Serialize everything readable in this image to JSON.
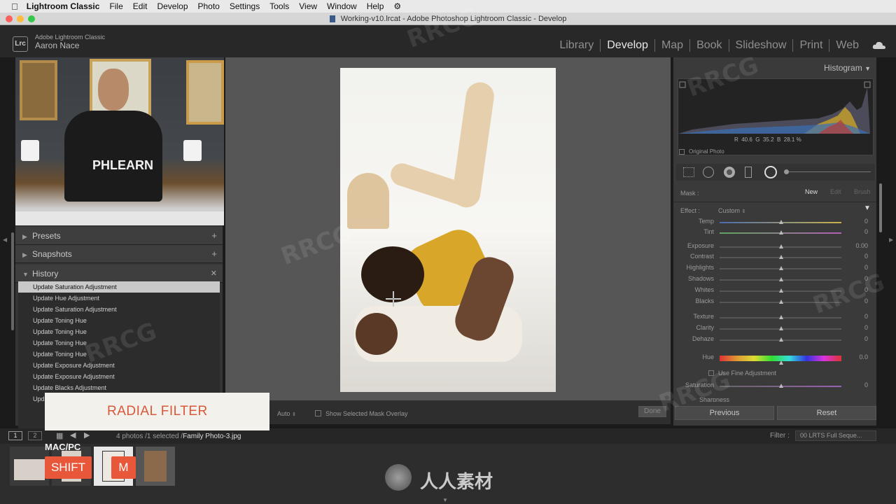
{
  "menubar": {
    "app_name": "Lightroom Classic",
    "items": [
      "File",
      "Edit",
      "Develop",
      "Photo",
      "Settings",
      "Tools",
      "View",
      "Window",
      "Help"
    ]
  },
  "window": {
    "title": "Working-v10.lrcat - Adobe Photoshop Lightroom Classic - Develop"
  },
  "identity": {
    "badge": "Lrc",
    "product": "Adobe Lightroom Classic",
    "user": "Aaron Nace"
  },
  "modules": [
    "Library",
    "Develop",
    "Map",
    "Book",
    "Slideshow",
    "Print",
    "Web"
  ],
  "presenter_shirt": "PHLEARN",
  "left_panel": {
    "presets": "Presets",
    "snapshots": "Snapshots",
    "history": "History",
    "history_items": [
      "Update Saturation Adjustment",
      "Update Hue Adjustment",
      "Update Saturation Adjustment",
      "Update Toning Hue",
      "Update Toning Hue",
      "Update Toning Hue",
      "Update Toning Hue",
      "Update Exposure Adjustment",
      "Update Exposure Adjustment",
      "Update Blacks Adjustment",
      "Upd"
    ]
  },
  "toolbar": {
    "auto": "Auto",
    "overlay": "Show Selected Mask Overlay",
    "done": "Done"
  },
  "overlay": {
    "title": "RADIAL FILTER",
    "platform": "MAC/PC",
    "key1": "SHIFT",
    "key2": "M"
  },
  "right_panel": {
    "histogram": "Histogram",
    "rgb": {
      "r_label": "R",
      "r": "40.6",
      "g_label": "G",
      "g": "35.2",
      "b_label": "B",
      "b": "28.1",
      "unit": "%"
    },
    "original_photo": "Original Photo",
    "mask_label": "Mask :",
    "mask_new": "New",
    "mask_edit": "Edit",
    "mask_brush": "Brush",
    "effect_label": "Effect :",
    "effect_value": "Custom",
    "sliders": [
      {
        "label": "Temp",
        "value": "0"
      },
      {
        "label": "Tint",
        "value": "0"
      },
      {
        "label": "Exposure",
        "value": "0.00"
      },
      {
        "label": "Contrast",
        "value": "0"
      },
      {
        "label": "Highlights",
        "value": "0"
      },
      {
        "label": "Shadows",
        "value": "0"
      },
      {
        "label": "Whites",
        "value": "0"
      },
      {
        "label": "Blacks",
        "value": "0"
      },
      {
        "label": "Texture",
        "value": "0"
      },
      {
        "label": "Clarity",
        "value": "0"
      },
      {
        "label": "Dehaze",
        "value": "0"
      }
    ],
    "hue_label": "Hue",
    "hue_value": "0.0",
    "fine_adjust": "Use Fine Adjustment",
    "saturation_label": "Saturation",
    "saturation_value": "0",
    "sharpness_label": "Sharpness",
    "previous": "Previous",
    "reset": "Reset"
  },
  "filmstrip": {
    "page1": "1",
    "page2": "2",
    "info": "4 photos /1 selected /",
    "filename": "Family Photo-3.jpg",
    "filter_label": "Filter :",
    "filter_value": "00 LRTS Full Seque..."
  },
  "watermark": {
    "text": "RRCG",
    "logo_text": "人人素材"
  }
}
